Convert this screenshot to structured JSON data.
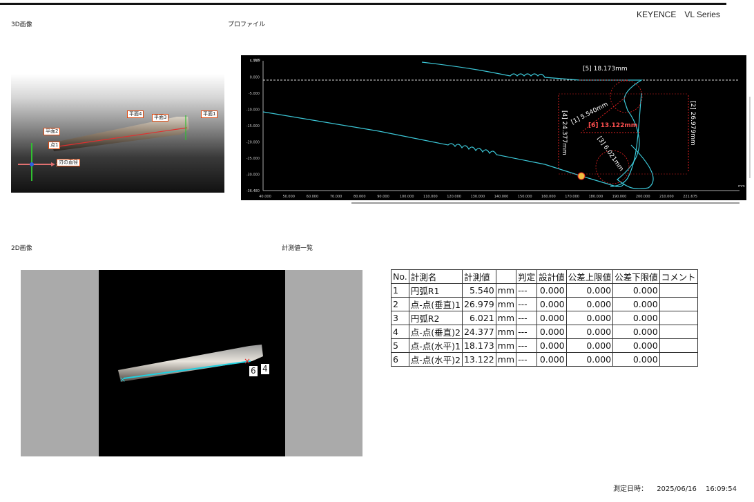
{
  "brand": "KEYENCE　VL Series",
  "sections": {
    "image3d": "3D画像",
    "profile": "プロファイル",
    "image2d": "2D画像",
    "measurements": "計測値一覧"
  },
  "view3d": {
    "tags": {
      "plane1": "平面1",
      "plane2": "平面2",
      "plane3": "平面3",
      "plane4": "平面4",
      "point1": "点1",
      "blade_diameter": "刃の直径"
    },
    "axis_x": "X"
  },
  "profile_chart": {
    "y_unit": "mm",
    "x_unit": "mm",
    "y_ticks": [
      "5.350",
      "0.000",
      "-5.000",
      "-10.000",
      "-15.000",
      "-20.000",
      "-25.000",
      "-30.000",
      "-36.480"
    ],
    "x_ticks": [
      "40.000",
      "50.000",
      "60.000",
      "70.000",
      "80.000",
      "90.000",
      "100.000",
      "110.000",
      "120.000",
      "130.000",
      "140.000",
      "150.000",
      "160.000",
      "170.000",
      "180.000",
      "190.000",
      "200.000",
      "210.000",
      "221.675"
    ],
    "labels": {
      "m1": "[1] 5.540mm",
      "m2": "[2] 26.979mm",
      "m3": "[3] 6.021mm",
      "m4": "[4] 24.377mm",
      "m5": "[5] 18.173mm",
      "m6": "[6] 13.122mm"
    },
    "colors": {
      "profile": "#3cc8d8",
      "measure": "#e02020"
    }
  },
  "view2d": {
    "markers": {
      "m6": "6",
      "m4": "4"
    }
  },
  "table": {
    "headers": [
      "No.",
      "計測名",
      "計測値",
      "",
      "判定",
      "設計値",
      "公差上限値",
      "公差下限値",
      "コメント"
    ],
    "rows": [
      [
        "1",
        "円弧R1",
        "5.540",
        "mm",
        "---",
        "0.000",
        "0.000",
        "0.000",
        ""
      ],
      [
        "2",
        "点-点(垂直)1",
        "26.979",
        "mm",
        "---",
        "0.000",
        "0.000",
        "0.000",
        ""
      ],
      [
        "3",
        "円弧R2",
        "6.021",
        "mm",
        "---",
        "0.000",
        "0.000",
        "0.000",
        ""
      ],
      [
        "4",
        "点-点(垂直)2",
        "24.377",
        "mm",
        "---",
        "0.000",
        "0.000",
        "0.000",
        ""
      ],
      [
        "5",
        "点-点(水平)1",
        "18.173",
        "mm",
        "---",
        "0.000",
        "0.000",
        "0.000",
        ""
      ],
      [
        "6",
        "点-点(水平)2",
        "13.122",
        "mm",
        "---",
        "0.000",
        "0.000",
        "0.000",
        ""
      ]
    ]
  },
  "footer": {
    "datetime_label": "測定日時：",
    "date": "2025/06/16",
    "time": "16:09:54"
  }
}
